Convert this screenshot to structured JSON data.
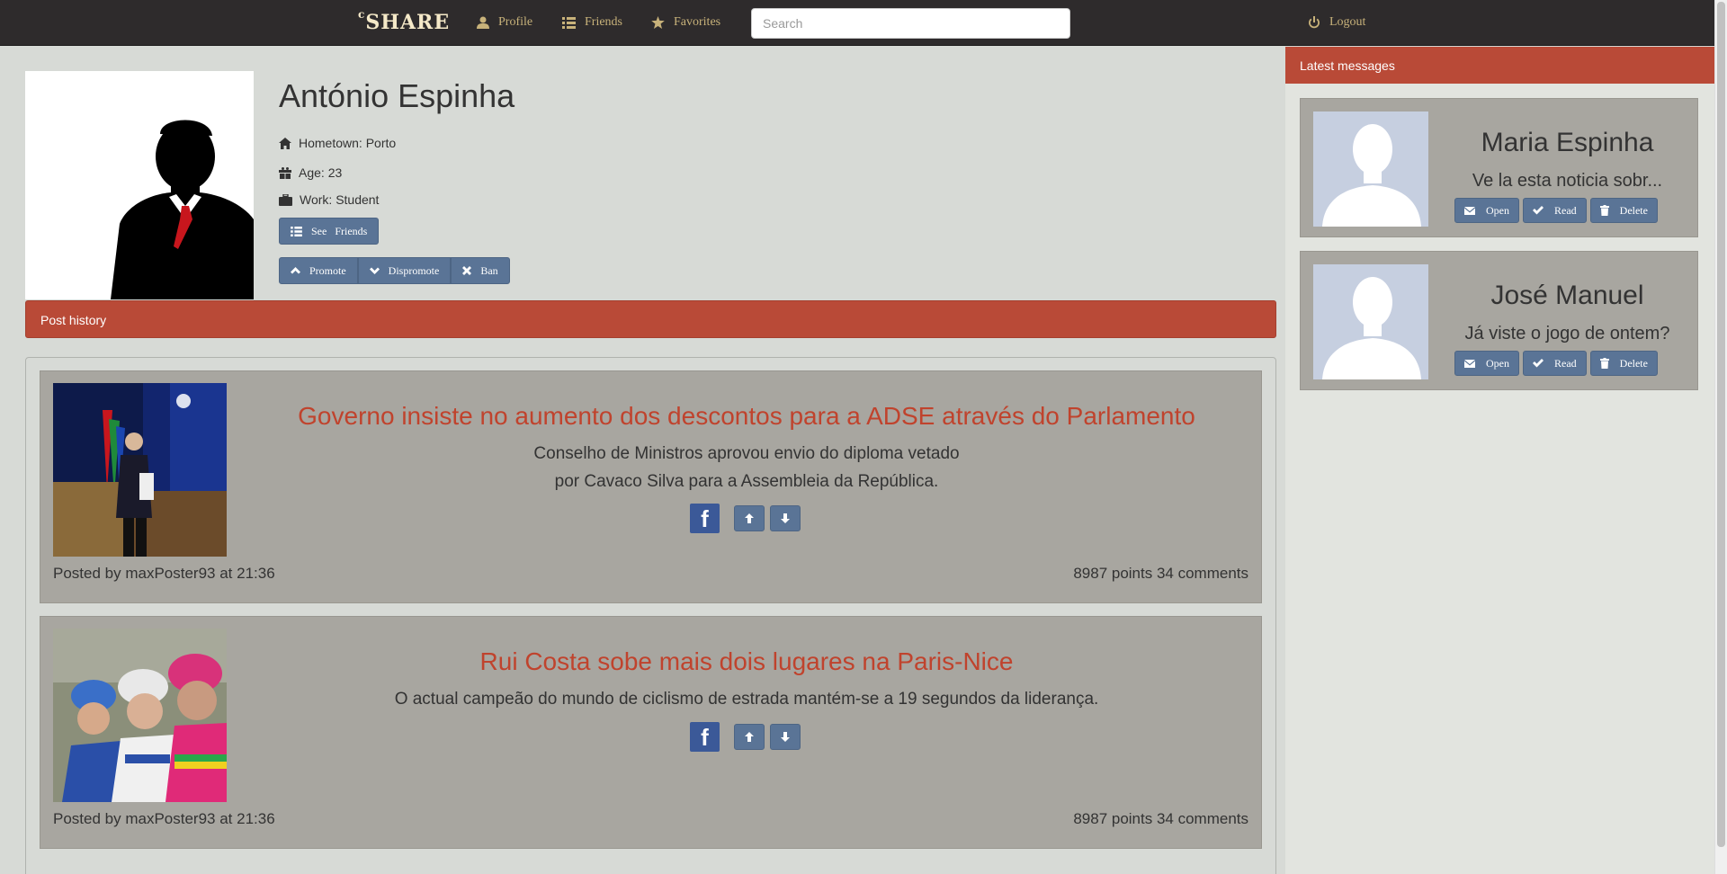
{
  "navbar": {
    "brand_sup": "c",
    "brand": "SHARE",
    "profile": "Profile",
    "friends": "Friends",
    "favorites": "Favorites",
    "search_placeholder": "Search",
    "logout": "Logout"
  },
  "profile": {
    "name": "António Espinha",
    "hometown": "Hometown: Porto",
    "age": "Age: 23",
    "work": "Work: Student",
    "see_friends": "See   Friends",
    "promote": "Promote",
    "dispromote": "Dispromote",
    "ban": "Ban"
  },
  "post_history_label": "Post history",
  "posts": [
    {
      "title": "Governo insiste no aumento dos descontos para a ADSE através do Parlamento",
      "desc_line1": "Conselho de Ministros aprovou envio do diploma vetado",
      "desc_line2": "por Cavaco Silva para a Assembleia da República.",
      "posted_by": "Posted by maxPoster93 at 21:36",
      "stats": "8987 points  34 comments",
      "fb": "f"
    },
    {
      "title": "Rui Costa sobe mais dois lugares na Paris-Nice",
      "desc_line1": "O actual campeão do mundo de ciclismo de estrada mantém-se a 19 segundos da liderança.",
      "posted_by": "Posted by maxPoster93 at 21:36",
      "stats": "8987 points  34 comments",
      "fb": "f"
    }
  ],
  "sidebar": {
    "header": "Latest messages",
    "messages": [
      {
        "name": "Maria Espinha",
        "preview": "Ve la esta noticia sobr...",
        "open": "Open",
        "read": "Read",
        "delete": "Delete"
      },
      {
        "name": "José Manuel",
        "preview": "Já viste o jogo de ontem?",
        "open": "Open",
        "read": "Read",
        "delete": "Delete"
      }
    ]
  },
  "colors": {
    "navbar": "#2e2b2c",
    "accent_red": "#b94a37",
    "button_blue": "#5a7496",
    "card_gray": "#a8a6a0",
    "title_red": "#c0432d"
  }
}
